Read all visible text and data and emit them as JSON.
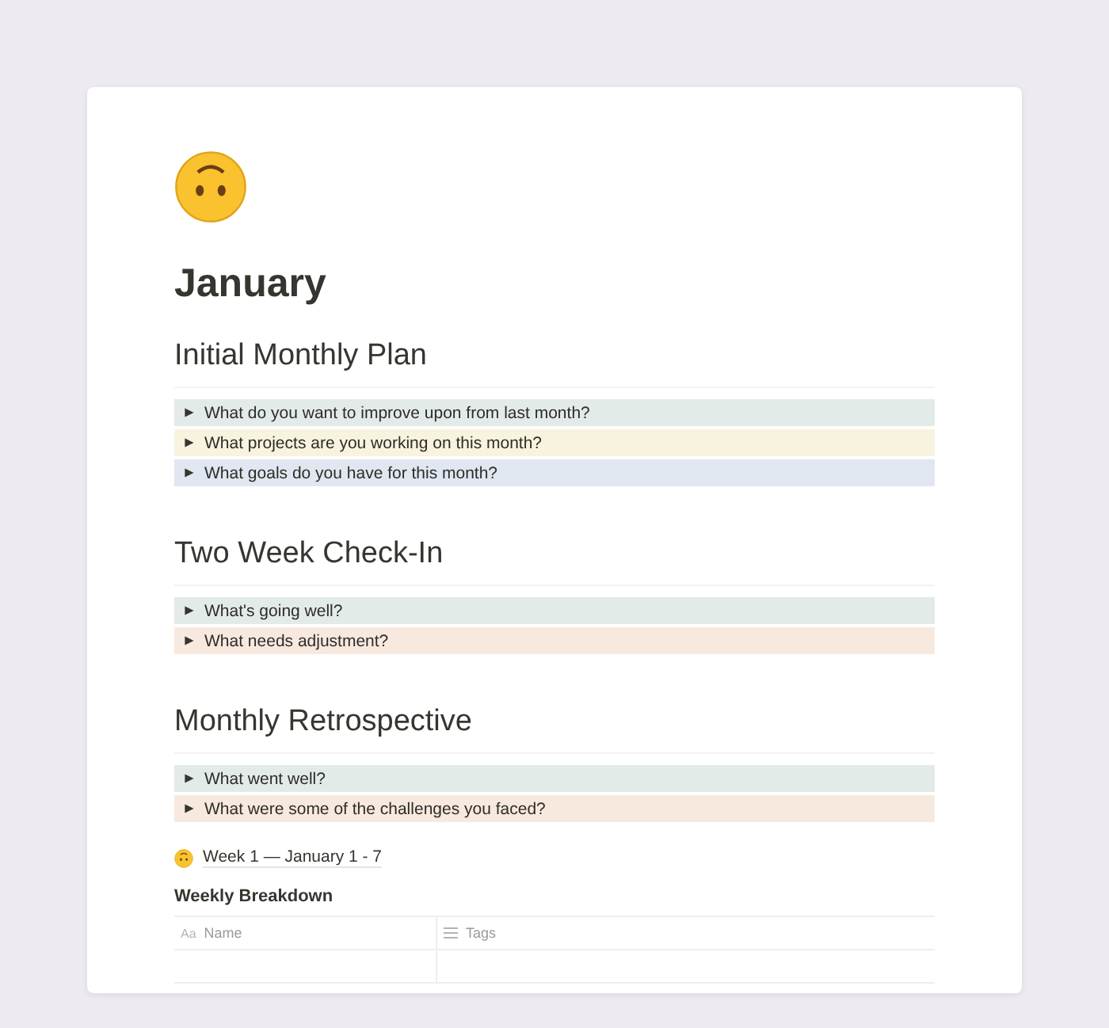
{
  "page": {
    "title": "January"
  },
  "sections": [
    {
      "heading": "Initial Monthly Plan",
      "toggles": [
        {
          "text": "What do you want to improve upon from last month?",
          "color": "#e3ebe8"
        },
        {
          "text": "What projects are you working on this month?",
          "color": "#f8f3df"
        },
        {
          "text": "What goals do you have for this month?",
          "color": "#e0e7f0"
        }
      ]
    },
    {
      "heading": "Two Week Check-In",
      "toggles": [
        {
          "text": "What's going well?",
          "color": "#e3ebe8"
        },
        {
          "text": "What needs adjustment?",
          "color": "#f8e9df"
        }
      ]
    },
    {
      "heading": "Monthly Retrospective",
      "toggles": [
        {
          "text": "What went well?",
          "color": "#e3ebe8"
        },
        {
          "text": "What were some of the challenges you faced?",
          "color": "#f8e9df"
        }
      ]
    }
  ],
  "subpage": {
    "label": "Week 1 — January 1 - 7"
  },
  "database": {
    "title": "Weekly Breakdown",
    "columns": [
      {
        "kind": "text",
        "icon": "Aa",
        "label": "Name"
      },
      {
        "kind": "list",
        "label": "Tags"
      }
    ]
  }
}
